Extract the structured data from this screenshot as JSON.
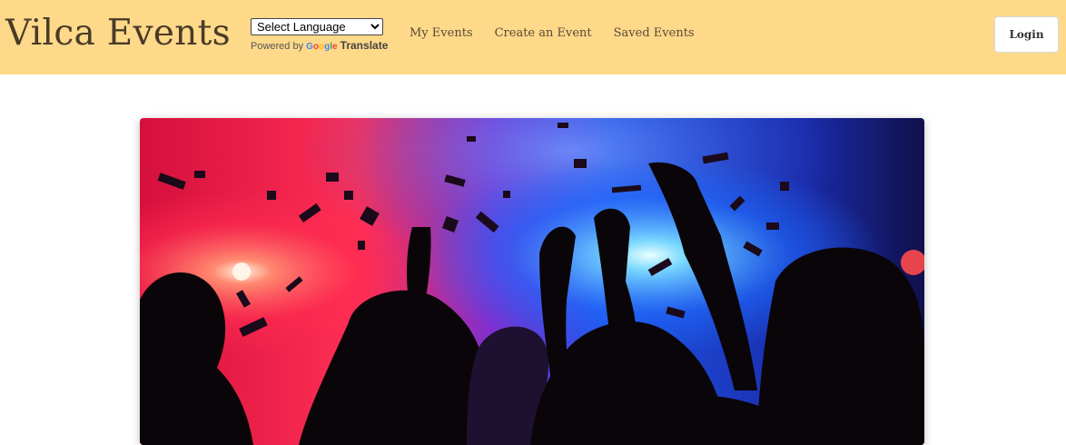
{
  "header": {
    "brand": "Vilca Events",
    "translate": {
      "select_label": "Select Language",
      "powered_by": "Powered by",
      "google_letters": [
        "G",
        "o",
        "o",
        "g",
        "l",
        "e"
      ],
      "google_colors": [
        "#4285F4",
        "#EA4335",
        "#FBBC05",
        "#4285F4",
        "#34A853",
        "#EA4335"
      ],
      "translate_label": "Translate"
    },
    "nav": [
      {
        "label": "My Events"
      },
      {
        "label": "Create an Event"
      },
      {
        "label": "Saved Events"
      }
    ],
    "login_label": "Login",
    "background_color": "#ffd98a",
    "text_color": "#4a3b28"
  },
  "hero": {
    "image": "concert-crowd-photo",
    "colors": {
      "left_light": "#ff1e4a",
      "center_haze": "#8a2cc8",
      "right_light": "#1a6bff",
      "glow": "#9ee8ff",
      "silhouette": "#0a0508"
    }
  }
}
